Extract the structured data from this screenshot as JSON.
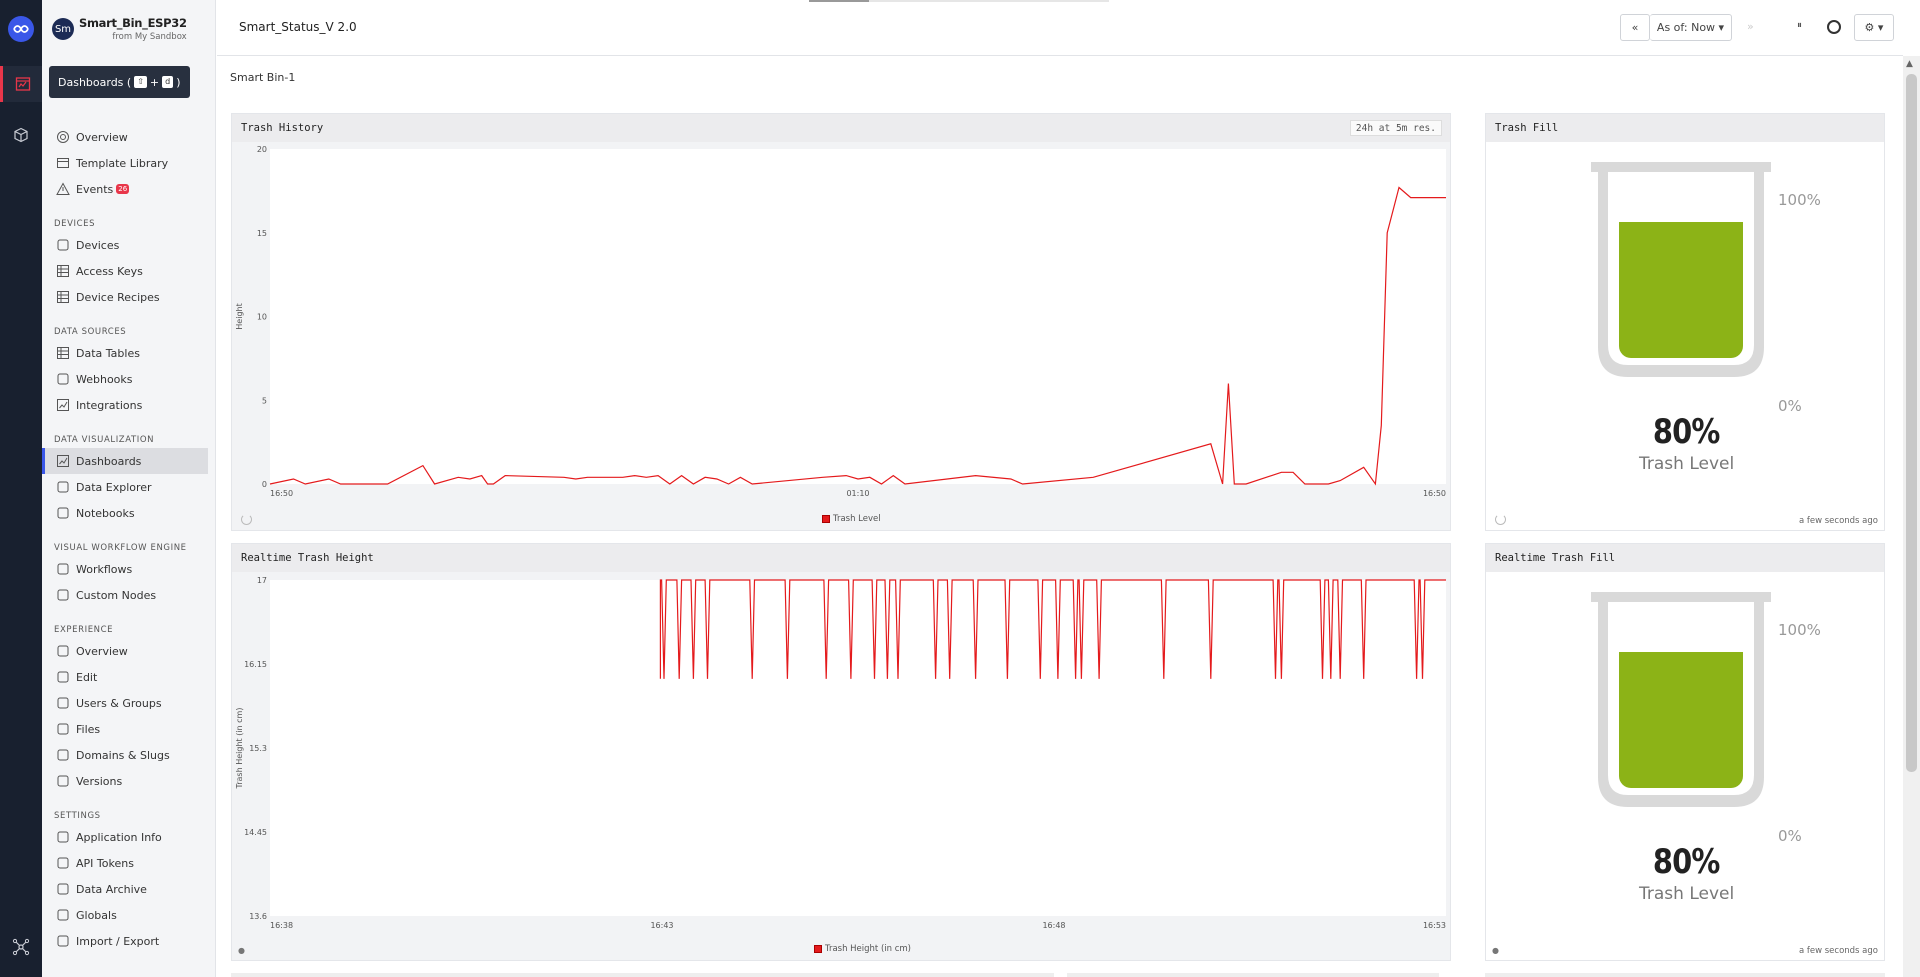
{
  "app": {
    "avatar_initials": "Sm",
    "name": "Smart_Bin_ESP32",
    "sandbox": "from My Sandbox"
  },
  "tooltip": {
    "label": "Dashboards (",
    "key1": "⇧",
    "plus": "+",
    "key2": "d",
    "close": ")"
  },
  "sidebar": {
    "top_items": [
      {
        "label": "Overview",
        "icon": "overview-icon"
      },
      {
        "label": "Template Library",
        "icon": "template-library-icon"
      },
      {
        "label": "Events",
        "icon": "warning-icon",
        "badge": "26"
      }
    ],
    "sections": [
      {
        "title": "DEVICES",
        "items": [
          "Devices",
          "Access Keys",
          "Device Recipes"
        ]
      },
      {
        "title": "DATA SOURCES",
        "items": [
          "Data Tables",
          "Webhooks",
          "Integrations"
        ]
      },
      {
        "title": "DATA VISUALIZATION",
        "items": [
          "Dashboards",
          "Data Explorer",
          "Notebooks"
        ]
      },
      {
        "title": "VISUAL WORKFLOW ENGINE",
        "items": [
          "Workflows",
          "Custom Nodes"
        ]
      },
      {
        "title": "EXPERIENCE",
        "items": [
          "Overview",
          "Edit",
          "Users & Groups",
          "Files",
          "Domains & Slugs",
          "Versions"
        ]
      },
      {
        "title": "SETTINGS",
        "items": [
          "Application Info",
          "API Tokens",
          "Data Archive",
          "Globals",
          "Import / Export"
        ]
      }
    ],
    "active_item": "Dashboards"
  },
  "header": {
    "dashboard_title": "Smart_Status_V 2.0",
    "rewind_icon": "«",
    "as_of_label": "As of: Now ▾",
    "forward_icon": "»",
    "pause_icon": "⏸",
    "settings_label": "⚙ ▾"
  },
  "content": {
    "breadcrumb": "Smart Bin-1"
  },
  "colors": {
    "series": "#e41a1c",
    "gauge_fill": "#8cb317",
    "gauge_shell": "#d9d9d9",
    "accent": "#3a57e8"
  },
  "panels": {
    "trash_history": {
      "title": "Trash History",
      "resolution": "24h at 5m res.",
      "ylabel": "Height",
      "legend": "Trash Level"
    },
    "trash_fill": {
      "title": "Trash Fill",
      "max_label": "100%",
      "min_label": "0%",
      "value_label": "80%",
      "caption": "Trash Level",
      "updated": "a few seconds ago",
      "fill": 0.8
    },
    "realtime_height": {
      "title": "Realtime Trash Height",
      "ylabel": "Trash Height (in cm)",
      "legend": "Trash Height (in cm)"
    },
    "realtime_fill": {
      "title": "Realtime Trash Fill",
      "max_label": "100%",
      "min_label": "0%",
      "value_label": "80%",
      "caption": "Trash Level",
      "updated": "a few seconds ago",
      "fill": 0.8
    }
  },
  "chart_data": [
    {
      "type": "line",
      "title": "Trash History",
      "ylabel": "Height",
      "ylim": [
        0,
        20
      ],
      "yticks": [
        "0",
        "5",
        "10",
        "15",
        "20"
      ],
      "xticks": [
        "16:50",
        "01:10",
        "16:50"
      ],
      "series": [
        {
          "name": "Trash Level",
          "x": [
            0,
            0.02,
            0.03,
            0.05,
            0.06,
            0.1,
            0.13,
            0.14,
            0.16,
            0.17,
            0.18,
            0.185,
            0.19,
            0.2,
            0.25,
            0.26,
            0.27,
            0.3,
            0.31,
            0.32,
            0.33,
            0.34,
            0.35,
            0.36,
            0.37,
            0.38,
            0.39,
            0.4,
            0.41,
            0.47,
            0.49,
            0.5,
            0.51,
            0.52,
            0.53,
            0.54,
            0.6,
            0.63,
            0.64,
            0.7,
            0.8,
            0.81,
            0.815,
            0.82,
            0.83,
            0.86,
            0.87,
            0.88,
            0.9,
            0.91,
            0.93,
            0.94,
            0.945,
            0.95,
            0.96,
            0.97,
            1.0
          ],
          "values": [
            0,
            0.3,
            0,
            0.3,
            0,
            0,
            1.1,
            0,
            0.4,
            0.3,
            0.5,
            0,
            0,
            0.5,
            0.4,
            0.3,
            0.4,
            0.4,
            0.5,
            0.4,
            0.5,
            0,
            0.5,
            0,
            0.4,
            0.3,
            0,
            0.4,
            0,
            0.4,
            0.5,
            0.3,
            0.4,
            0,
            0.5,
            0,
            0.5,
            0.3,
            0,
            0.4,
            2.4,
            0,
            6,
            0,
            0,
            0.7,
            0.7,
            0,
            0,
            0.2,
            1,
            0,
            3.5,
            15,
            17.7,
            17.1,
            17.1
          ]
        }
      ]
    },
    {
      "type": "line",
      "title": "Realtime Trash Height",
      "ylabel": "Trash Height (in cm)",
      "ylim": [
        13.6,
        17
      ],
      "yticks": [
        "13.6",
        "14.45",
        "15.3",
        "16.15",
        "17"
      ],
      "xticks": [
        "16:38",
        "16:43",
        "16:48",
        "16:53"
      ],
      "series": [
        {
          "name": "Trash Height (in cm)",
          "dips": [
            0.335,
            0.348,
            0.36,
            0.372,
            0.41,
            0.44,
            0.473,
            0.494,
            0.514,
            0.525,
            0.534,
            0.566,
            0.578,
            0.6,
            0.627,
            0.655,
            0.67,
            0.685,
            0.69,
            0.705,
            0.76,
            0.8,
            0.855,
            0.86,
            0.895,
            0.902,
            0.91,
            0.93,
            0.975,
            0.98
          ],
          "high": 17,
          "low": 16.0
        }
      ]
    }
  ]
}
